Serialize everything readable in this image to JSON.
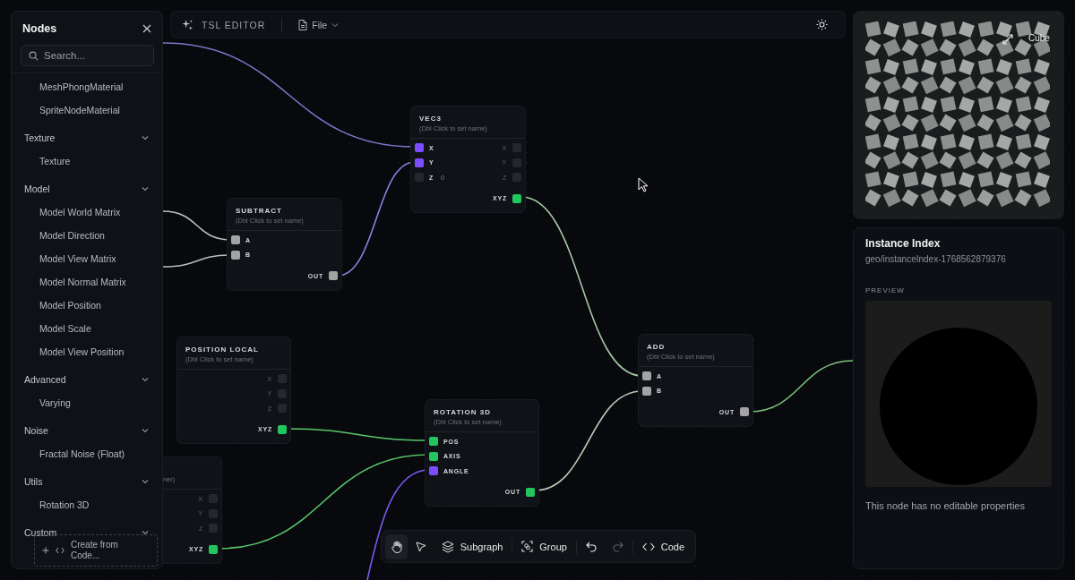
{
  "sidebar": {
    "title": "Nodes",
    "search": {
      "placeholder": "Search..."
    },
    "groups": [
      {
        "items": [
          "MeshPhongMaterial",
          "SpriteNodeMaterial"
        ]
      },
      {
        "label": "Texture",
        "expanded": true,
        "items": [
          "Texture"
        ]
      },
      {
        "label": "Model",
        "expanded": true,
        "items": [
          "Model World Matrix",
          "Model Direction",
          "Model View Matrix",
          "Model Normal Matrix",
          "Model Position",
          "Model Scale",
          "Model View Position"
        ]
      },
      {
        "label": "Advanced",
        "expanded": true,
        "items": [
          "Varying"
        ]
      },
      {
        "label": "Noise",
        "expanded": true,
        "items": [
          "Fractal Noise (Float)"
        ]
      },
      {
        "label": "Utils",
        "expanded": true,
        "items": [
          "Rotation 3D"
        ]
      },
      {
        "label": "Custom",
        "expanded": true
      }
    ],
    "create_button": "Create from Code..."
  },
  "toolbar": {
    "title": "TSL EDITOR",
    "menu": "File"
  },
  "nodes": [
    {
      "title": "VEC3",
      "subtitle": "(Dbl Click to set name)",
      "rows": [
        {
          "in": {
            "label": "X",
            "color": "#7c4dff"
          },
          "out": {
            "label": "X",
            "color": "#24272d"
          }
        },
        {
          "in": {
            "label": "Y",
            "color": "#7c4dff"
          },
          "out": {
            "label": "Y",
            "color": "#24272d"
          }
        },
        {
          "in": {
            "label": "Z",
            "value": "0",
            "color": "#24272d"
          },
          "out": {
            "label": "Z",
            "color": "#24272d"
          }
        }
      ],
      "outputs": [
        {
          "label": "XYZ",
          "color": "#22c55e"
        }
      ]
    },
    {
      "title": "SUBTRACT",
      "subtitle": "(Dbl Click to set name)",
      "rows": [
        {
          "in": {
            "label": "A",
            "color": "#a3a3a3"
          }
        },
        {
          "in": {
            "label": "B",
            "color": "#a3a3a3"
          }
        }
      ],
      "outputs": [
        {
          "label": "OUT",
          "color": "#a3a3a3"
        }
      ]
    },
    {
      "title": "POSITION LOCAL",
      "subtitle": "(Dbl Click to set name)",
      "rows": [
        {
          "out": {
            "label": "X",
            "color": "#24272d"
          }
        },
        {
          "out": {
            "label": "Y",
            "color": "#24272d"
          }
        },
        {
          "out": {
            "label": "Z",
            "color": "#24272d"
          }
        }
      ],
      "outputs": [
        {
          "label": "XYZ",
          "color": "#22c55e"
        }
      ]
    },
    {
      "subtitle": "ner)",
      "rows": [
        {
          "out": {
            "label": "X",
            "color": "#24272d"
          }
        },
        {
          "out": {
            "label": "Y",
            "color": "#24272d"
          }
        },
        {
          "out": {
            "label": "Z",
            "color": "#24272d"
          }
        }
      ],
      "outputs": [
        {
          "label": "XYZ",
          "color": "#22c55e"
        }
      ]
    },
    {
      "title": "ROTATION 3D",
      "subtitle": "(Dbl Click to set name)",
      "rows": [
        {
          "in": {
            "label": "POS",
            "color": "#22c55e"
          }
        },
        {
          "in": {
            "label": "AXIS",
            "color": "#22c55e"
          }
        },
        {
          "in": {
            "label": "ANGLE",
            "color": "#7c4dff"
          }
        }
      ],
      "outputs": [
        {
          "label": "OUT",
          "color": "#22c55e"
        }
      ]
    },
    {
      "title": "ADD",
      "subtitle": "(Dbl Click to set name)",
      "rows": [
        {
          "in": {
            "label": "A",
            "color": "#a3a3a3"
          }
        },
        {
          "in": {
            "label": "B",
            "color": "#a3a3a3"
          }
        }
      ],
      "outputs": [
        {
          "label": "OUT",
          "color": "#a3a3a3"
        }
      ]
    }
  ],
  "bottom_toolbar": {
    "tools": [
      {
        "kind": "hand",
        "selected": true
      },
      {
        "kind": "pointer",
        "selected": false
      }
    ],
    "buttons": [
      {
        "kind": "subgraph",
        "label": "Subgraph"
      },
      {
        "kind": "group",
        "label": "Group"
      },
      {
        "kind": "undo",
        "disabled": false
      },
      {
        "kind": "redo",
        "disabled": true
      },
      {
        "kind": "code",
        "label": "Code"
      }
    ]
  },
  "preview": {
    "label": "Cube"
  },
  "inspector": {
    "title": "Instance Index",
    "id": "geo/instanceIndex-1768562879376",
    "section": "PREVIEW",
    "message": "This node has no editable properties"
  }
}
